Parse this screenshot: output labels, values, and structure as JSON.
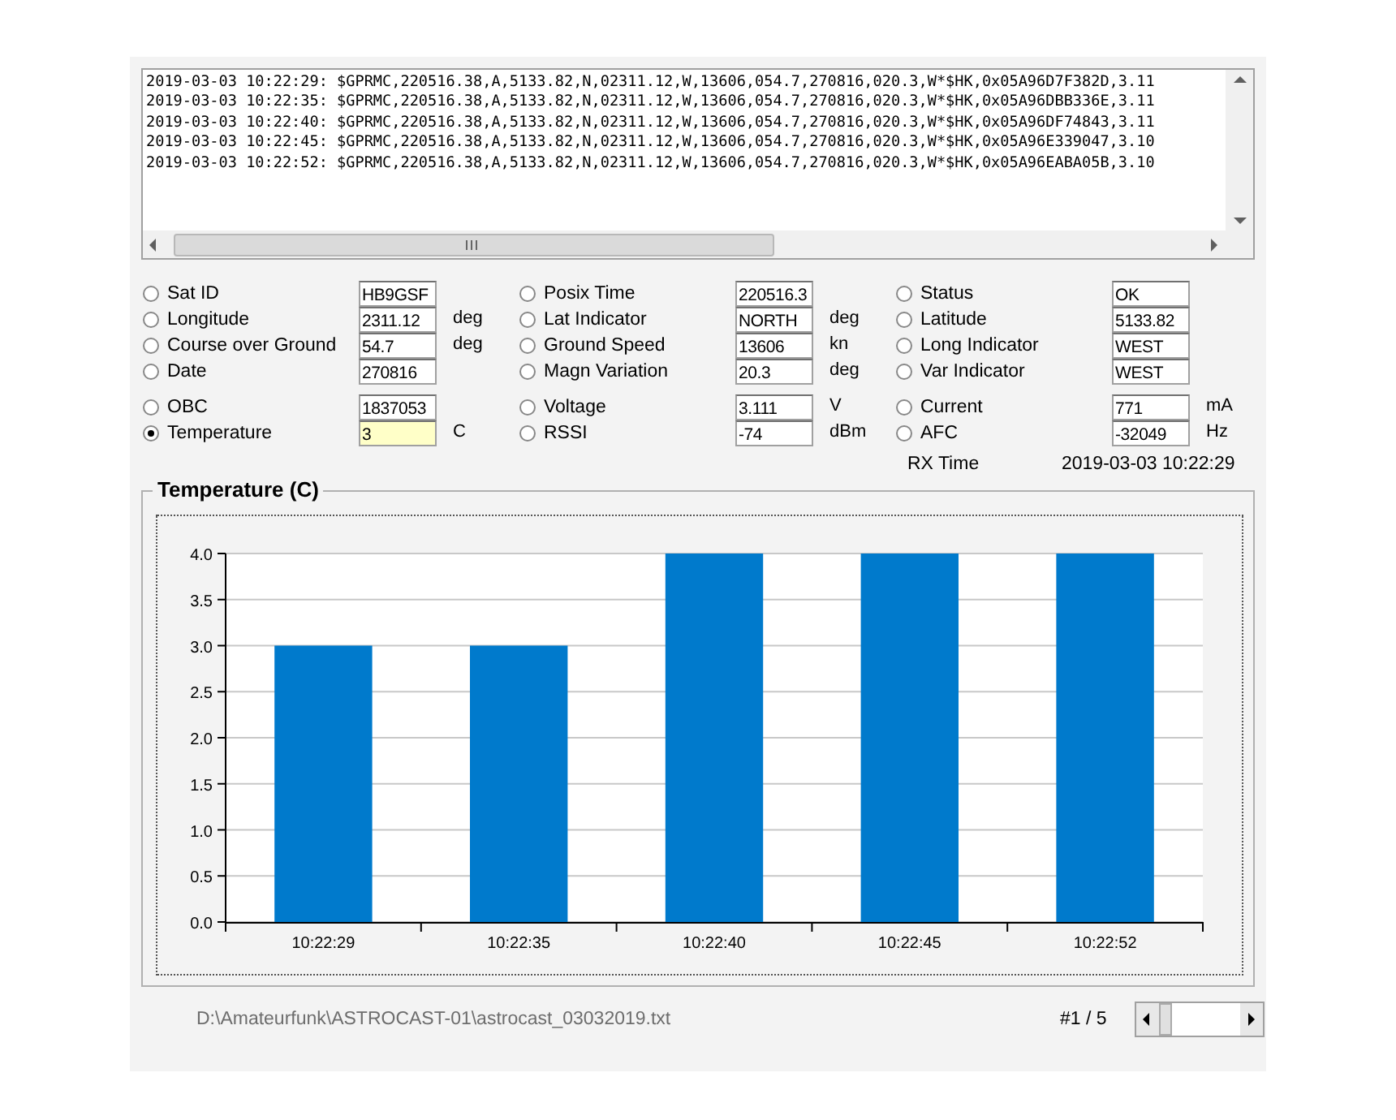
{
  "log": {
    "lines": [
      "2019-03-03 10:22:29: $GPRMC,220516.38,A,5133.82,N,02311.12,W,13606,054.7,270816,020.3,W*$HK,0x05A96D7F382D,3.11",
      "2019-03-03 10:22:35: $GPRMC,220516.38,A,5133.82,N,02311.12,W,13606,054.7,270816,020.3,W*$HK,0x05A96DBB336E,3.11",
      "2019-03-03 10:22:40: $GPRMC,220516.38,A,5133.82,N,02311.12,W,13606,054.7,270816,020.3,W*$HK,0x05A96DF74843,3.11",
      "2019-03-03 10:22:45: $GPRMC,220516.38,A,5133.82,N,02311.12,W,13606,054.7,270816,020.3,W*$HK,0x05A96E339047,3.10",
      "2019-03-03 10:22:52: $GPRMC,220516.38,A,5133.82,N,02311.12,W,13606,054.7,270816,020.3,W*$HK,0x05A96EABA05B,3.10"
    ]
  },
  "field_groups": [
    {
      "fields": [
        {
          "label": "Sat ID",
          "value": "HB9GSF",
          "selected": false
        },
        {
          "label": "Posix Time",
          "value": "220516.3",
          "selected": false
        },
        {
          "label": "Status",
          "value": "OK",
          "selected": false
        },
        {
          "label": "Longitude",
          "value": "2311.12",
          "unit": "deg",
          "selected": false
        },
        {
          "label": "Lat Indicator",
          "value": "NORTH",
          "unit": "deg",
          "selected": false
        },
        {
          "label": "Latitude",
          "value": "5133.82",
          "selected": false
        },
        {
          "label": "Course over Ground",
          "value": "54.7",
          "unit": "deg",
          "selected": false
        },
        {
          "label": "Ground Speed",
          "value": "13606",
          "unit": "kn",
          "selected": false
        },
        {
          "label": "Long Indicator",
          "value": "WEST",
          "selected": false
        },
        {
          "label": "Date",
          "value": "270816",
          "selected": false
        },
        {
          "label": "Magn Variation",
          "value": "20.3",
          "unit": "deg",
          "selected": false
        },
        {
          "label": "Var Indicator",
          "value": "WEST",
          "selected": false
        }
      ]
    },
    {
      "fields": [
        {
          "label": "OBC",
          "value": "1837053",
          "selected": false
        },
        {
          "label": "Voltage",
          "value": "3.111",
          "unit": "V",
          "selected": false
        },
        {
          "label": "Current",
          "value": "771",
          "unit": "mA",
          "selected": false
        },
        {
          "label": "Temperature",
          "value": "3",
          "unit": "C",
          "selected": true
        },
        {
          "label": "RSSI",
          "value": "-74",
          "unit": "dBm",
          "selected": false
        },
        {
          "label": "AFC",
          "value": "-32049",
          "unit": "Hz",
          "selected": false
        }
      ]
    }
  ],
  "rx_time": {
    "label": "RX Time",
    "value": "2019-03-03 10:22:29"
  },
  "chart": {
    "chart_data": {
      "type": "bar",
      "title": "Temperature (C)",
      "categories": [
        "10:22:29",
        "10:22:35",
        "10:22:40",
        "10:22:45",
        "10:22:52"
      ],
      "series": [
        {
          "color": "#007acc",
          "values": [
            3,
            3,
            4,
            4,
            4
          ]
        }
      ],
      "grid": true,
      "ylim": [
        0,
        4
      ],
      "yticks": [
        {
          "value": 0,
          "label": "0.0"
        },
        {
          "value": 0.5,
          "label": "0.5"
        },
        {
          "value": 1,
          "label": "1.0"
        },
        {
          "value": 1.5,
          "label": "1.5"
        },
        {
          "value": 2,
          "label": "2.0"
        },
        {
          "value": 2.5,
          "label": "2.5"
        },
        {
          "value": 3,
          "label": "3.0"
        },
        {
          "value": 3.5,
          "label": "3.5"
        },
        {
          "value": 4,
          "label": "4.0"
        }
      ]
    }
  },
  "footer": {
    "file_path": "D:\\Amateurfunk\\ASTROCAST-01\\astrocast_03032019.txt",
    "record_counter": "#1 / 5"
  }
}
